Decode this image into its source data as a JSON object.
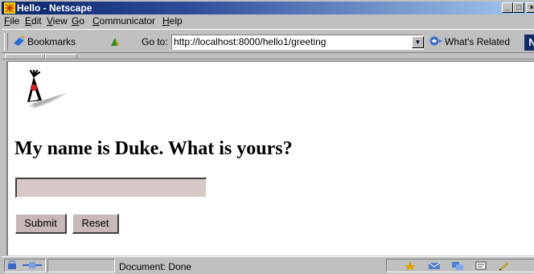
{
  "window": {
    "title": "Hello - Netscape",
    "controls": {
      "minimize": "_",
      "maximize": "□",
      "close": "×"
    }
  },
  "menubar": {
    "items": [
      {
        "label": "File",
        "mnemonic": "F"
      },
      {
        "label": "Edit",
        "mnemonic": "E"
      },
      {
        "label": "View",
        "mnemonic": "V"
      },
      {
        "label": "Go",
        "mnemonic": "G"
      },
      {
        "label": "Communicator",
        "mnemonic": "C"
      },
      {
        "label": "Help",
        "mnemonic": "H"
      }
    ]
  },
  "toolbar": {
    "bookmarks_label": "Bookmarks",
    "goto_label": "Go to:",
    "url": "http://localhost:8000/hello1/greeting",
    "related_label": "What's Related",
    "logo_letter": "N"
  },
  "page": {
    "heading": "My name is Duke. What is yours?",
    "name_input": {
      "value": "",
      "placeholder": ""
    },
    "submit_label": "Submit",
    "reset_label": "Reset"
  },
  "status": {
    "text": "Document: Done"
  },
  "colors": {
    "titlebar_start": "#0a246a",
    "titlebar_end": "#a6caf0",
    "chrome": "#c0c0c0",
    "form_field": "#d8c8c8"
  }
}
